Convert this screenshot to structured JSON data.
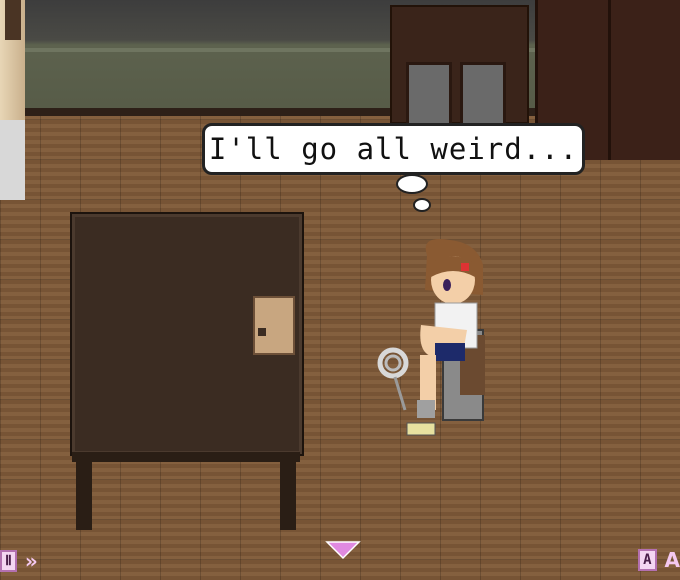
{
  "dialogue": {
    "text": "I'll go all weird...",
    "speaker": ""
  },
  "hud": {
    "left_key_icon": "pause-icon",
    "left_key_label": "Ⅱ",
    "fast_forward_icon": "skip-icon",
    "fast_forward_glyph": "»",
    "right_key_icon": "auto-icon",
    "right_key_label": "A",
    "right_extra_glyph": "A"
  },
  "advance_indicator": {
    "icon": "down-triangle-icon",
    "color": "#e08ae0"
  },
  "colors": {
    "floor": "#7d5838",
    "table": "#3b2c22",
    "bubble_border": "#222222",
    "hud_accent": "#f4d6f2"
  }
}
